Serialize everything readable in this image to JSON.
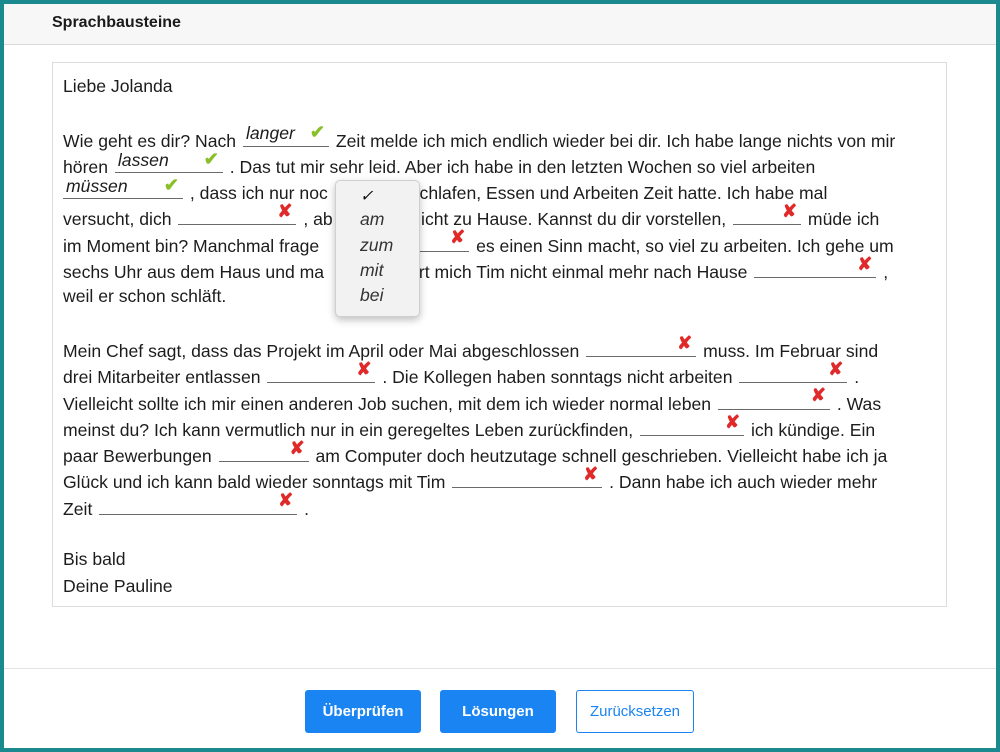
{
  "window": {
    "title": "Sprachbausteine"
  },
  "letter": {
    "greeting": "Liebe Jolanda",
    "p1": {
      "l1_a": "Wie geht es dir? Nach ",
      "l1_b": " Zeit melde ich mich endlich wieder bei dir. Ich habe lange nichts von mir",
      "l2_a": "hören ",
      "l2_b": " . Das tut mir sehr leid. Aber ich habe in den letzten Wochen so viel arbeiten",
      "l3_b": " , dass ich nur noc",
      "l3_c": "Schlafen, Essen und Arbeiten Zeit hatte. Ich habe mal",
      "l4_a": "versucht, dich ",
      "l4_b": " , ab",
      "l4_c": "st nicht zu Hause. Kannst du dir vorstellen, ",
      "l4_d": " müde ich",
      "l5_a": "im Moment bin? Manchmal frage",
      "l5_b": " es einen Sinn macht, so viel zu arbeiten. Ich gehe um",
      "l6_a": "sechs Uhr aus dem Haus und ma",
      "l6_b": "ört mich Tim nicht einmal mehr nach Hause ",
      "l6_c": " ,",
      "l7_a": "weil er schon schläft."
    },
    "p2": {
      "l1_a": "Mein Chef sagt, dass das Projekt im April oder Mai abgeschlossen ",
      "l1_b": " muss. Im Februar sind",
      "l2_a": "drei Mitarbeiter entlassen ",
      "l2_b": " . Die Kollegen haben sonntags nicht arbeiten ",
      "l2_c": " .",
      "l3_a": "Vielleicht sollte ich mir einen anderen Job suchen, mit dem ich wieder normal leben ",
      "l3_b": " . Was",
      "l4_a": "meinst du? Ich kann vermutlich nur in ein geregeltes Leben zurückfinden, ",
      "l4_b": " ich kündige. Ein",
      "l5_a": "paar Bewerbungen ",
      "l5_b": " am Computer doch heutzutage schnell geschrieben. Vielleicht habe ich ja",
      "l6_a": "Glück und ich kann bald wieder sonntags mit Tim ",
      "l6_b": " . Dann habe ich auch wieder mehr",
      "l7_a": "Zeit ",
      "l7_b": " ."
    },
    "closing1": "Bis bald",
    "closing2": "Deine Pauline"
  },
  "answers": {
    "b1": {
      "value": "langer",
      "mark": "✔"
    },
    "b2": {
      "value": "lassen",
      "mark": "✔"
    },
    "b3": {
      "value": "müssen",
      "mark": "✔"
    },
    "wrong_mark": "✘"
  },
  "dropdown": {
    "check": "✓",
    "options": [
      "am",
      "zum",
      "mit",
      "bei"
    ]
  },
  "buttons": {
    "check": "Überprüfen",
    "solutions": "Lösungen",
    "reset": "Zurücksetzen"
  },
  "colors": {
    "accent": "#1a84f2",
    "frame": "#1a8a8e",
    "correct": "#8bbf2a",
    "wrong": "#e02a2a"
  }
}
